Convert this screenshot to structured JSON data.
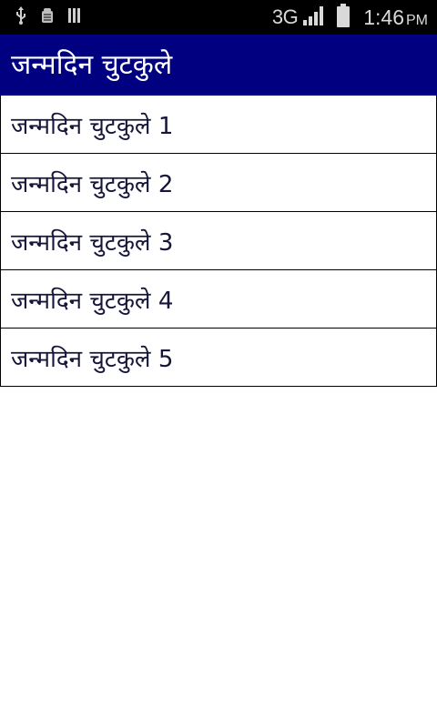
{
  "status_bar": {
    "icons_left": [
      "usb-icon",
      "android-debug-icon",
      "storage-icon"
    ],
    "network_type": "3G",
    "signal_icon": "signal-bars-icon",
    "battery_icon": "battery-icon",
    "time": "1:46",
    "ampm": "PM"
  },
  "app_bar": {
    "title": "जन्मदिन चुटकुले",
    "background": "#000080"
  },
  "list": {
    "items": [
      {
        "label": "जन्मदिन चुटकुले 1"
      },
      {
        "label": "जन्मदिन चुटकुले 2"
      },
      {
        "label": "जन्मदिन चुटकुले 3"
      },
      {
        "label": "जन्मदिन चुटकुले 4"
      },
      {
        "label": "जन्मदिन चुटकुले 5"
      }
    ]
  }
}
